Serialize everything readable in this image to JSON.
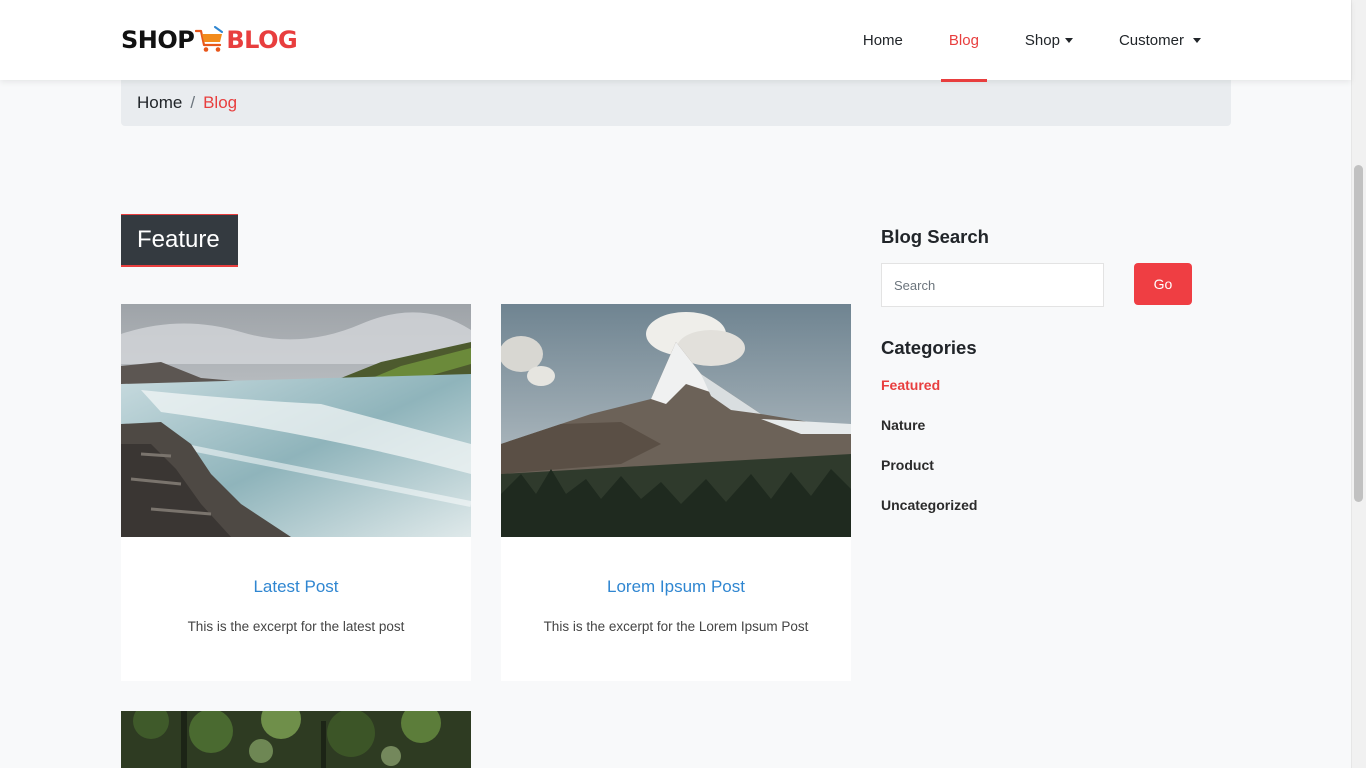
{
  "brand": {
    "part1": "SHOP",
    "part2": "BLOG",
    "icon": "cart-icon",
    "accent": "#e83e3e"
  },
  "nav": {
    "items": [
      {
        "label": "Home",
        "active": false,
        "dropdown": false
      },
      {
        "label": "Blog",
        "active": true,
        "dropdown": false
      },
      {
        "label": "Shop",
        "active": false,
        "dropdown": true
      },
      {
        "label": "Customer",
        "active": false,
        "dropdown": true
      }
    ]
  },
  "breadcrumb": {
    "home": "Home",
    "separator": "/",
    "current": "Blog"
  },
  "feature": {
    "heading": "Feature"
  },
  "posts": [
    {
      "title": "Latest Post",
      "excerpt": "This is the excerpt for the latest post"
    },
    {
      "title": "Lorem Ipsum Post",
      "excerpt": "This is the excerpt for the Lorem Ipsum Post"
    }
  ],
  "sidebar": {
    "search_heading": "Blog Search",
    "search_placeholder": "Search",
    "go_label": "Go",
    "categories_heading": "Categories",
    "categories": [
      {
        "label": "Featured",
        "active": true
      },
      {
        "label": "Nature",
        "active": false
      },
      {
        "label": "Product",
        "active": false
      },
      {
        "label": "Uncategorized",
        "active": false
      }
    ]
  },
  "colors": {
    "accent": "#e83e3e",
    "link": "#2f86d1",
    "dark": "#343a40"
  }
}
